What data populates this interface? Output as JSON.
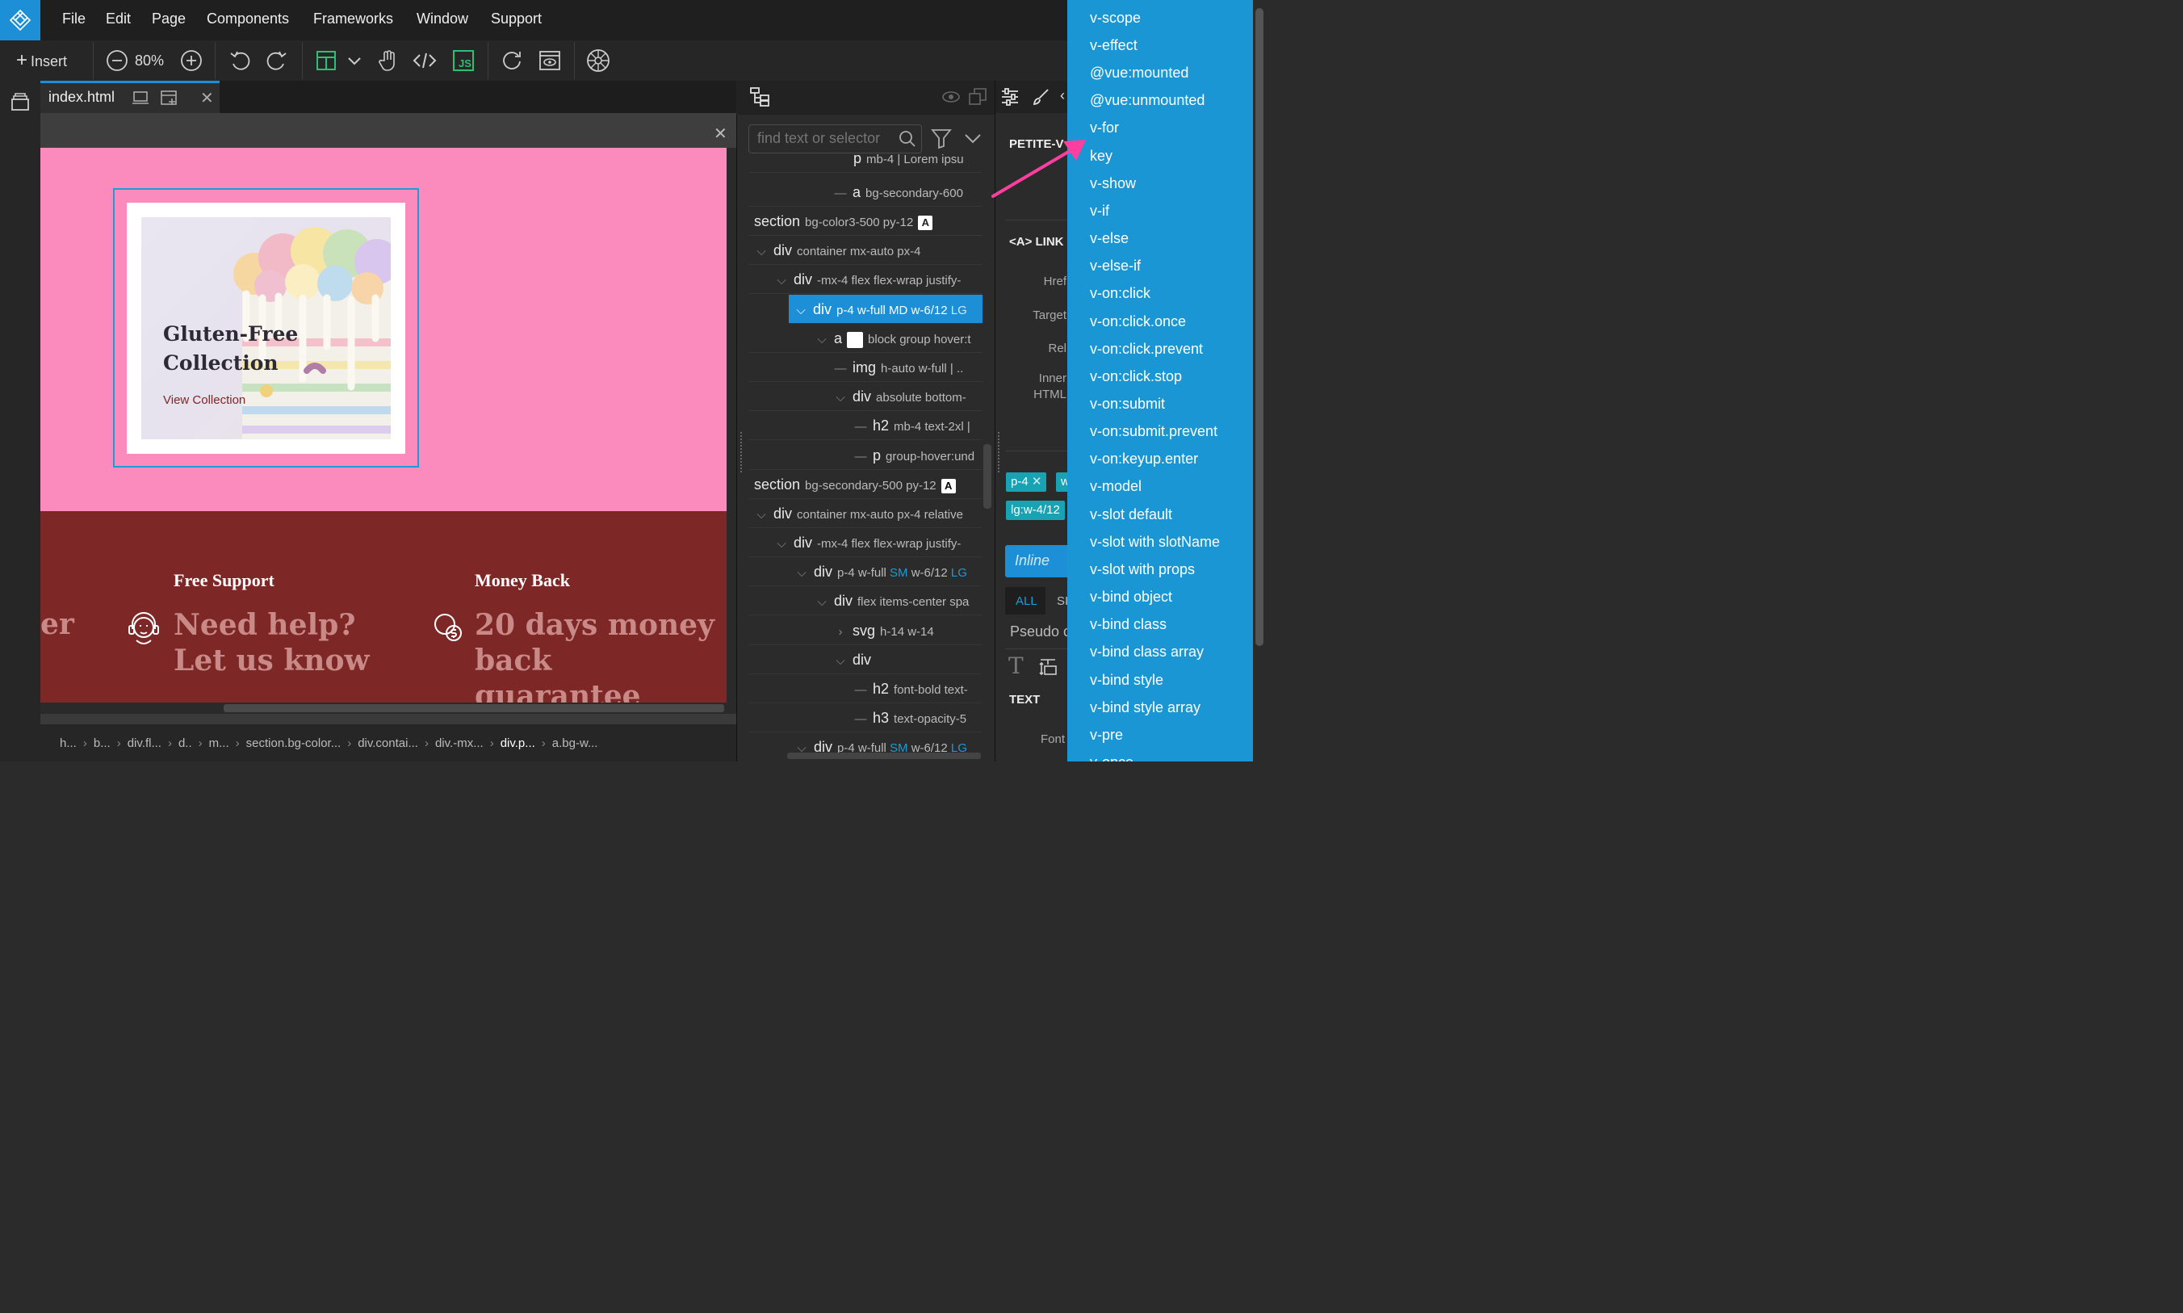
{
  "menubar": {
    "items": [
      "File",
      "Edit",
      "Page",
      "Components",
      "Frameworks",
      "Window",
      "Support"
    ]
  },
  "toolbar": {
    "insert_label": "Insert",
    "zoom": "80%"
  },
  "tab": {
    "filename": "index.html"
  },
  "page": {
    "card_title": "Gluten-Free Collection",
    "card_link": "View Collection",
    "feature_partial": "er",
    "feature1_title": "Free Support",
    "feature1_text": "Need help? Let us know",
    "feature2_title": "Money Back",
    "feature2_text": "20 days money back guarantee"
  },
  "breadcrumbs": [
    "h...",
    "b...",
    "div.fl...",
    "d..",
    "m...",
    "section.bg-color...",
    "div.contai...",
    "div.-mx...",
    "div.p...",
    "a.bg-w..."
  ],
  "tree": {
    "search_placeholder": "find text or selector",
    "rows": [
      {
        "tag": "p",
        "cls": "mb-4 | Lorem ipsu"
      },
      {
        "tag": "a",
        "cls": "bg-secondary-600"
      },
      {
        "tag": "section",
        "cls": "bg-color3-500 py-12",
        "badge": "A"
      },
      {
        "tag": "div",
        "cls": "container mx-auto px-4"
      },
      {
        "tag": "div",
        "cls": "-mx-4 flex flex-wrap justify-"
      },
      {
        "tag": "div",
        "cls": "p-4 w-full",
        "bp1": "MD",
        "cls2": "w-6/12",
        "bp2": "LG"
      },
      {
        "tag": "a",
        "cls": "block group hover:t"
      },
      {
        "tag": "img",
        "cls": "h-auto w-full | .."
      },
      {
        "tag": "div",
        "cls": "absolute bottom-"
      },
      {
        "tag": "h2",
        "cls": "mb-4 text-2xl |"
      },
      {
        "tag": "p",
        "cls": "group-hover:und"
      },
      {
        "tag": "section",
        "cls": "bg-secondary-500 py-12",
        "badge": "A"
      },
      {
        "tag": "div",
        "cls": "container mx-auto px-4 relative"
      },
      {
        "tag": "div",
        "cls": "-mx-4 flex flex-wrap justify-"
      },
      {
        "tag": "div",
        "cls": "p-4 w-full",
        "bp1": "SM",
        "cls2": "w-6/12",
        "bp2": "LG"
      },
      {
        "tag": "div",
        "cls": "flex items-center spa"
      },
      {
        "tag": "svg",
        "cls": "h-14 w-14"
      },
      {
        "tag": "div",
        "cls": ""
      },
      {
        "tag": "h2",
        "cls": "font-bold text-"
      },
      {
        "tag": "h3",
        "cls": "text-opacity-5"
      },
      {
        "tag": "div",
        "cls": "p-4 w-full",
        "bp1": "SM",
        "cls2": "w-6/12",
        "bp2": "LG"
      }
    ]
  },
  "props": {
    "section_title": "PETITE-V",
    "element_title": "<A> LINK",
    "href_label": "Href",
    "target_label": "Target",
    "rel_label": "Rel",
    "inner_html_label_1": "Inner",
    "inner_html_label_2": "HTML",
    "chip1": "p-4",
    "chip2": "w",
    "chip3": "lg:w-4/12",
    "inline_label": "Inline",
    "tab_all": "ALL",
    "tab_s": "SI",
    "pseudo_label": "Pseudo c",
    "text_heading": "TEXT",
    "font_label": "Font"
  },
  "dropdown": {
    "items": [
      "v-scope",
      "v-effect",
      "@vue:mounted",
      "@vue:unmounted",
      "v-for",
      "key",
      "v-show",
      "v-if",
      "v-else",
      "v-else-if",
      "v-on:click",
      "v-on:click.once",
      "v-on:click.prevent",
      "v-on:click.stop",
      "v-on:submit",
      "v-on:submit.prevent",
      "v-on:keyup.enter",
      "v-model",
      "v-slot default",
      "v-slot with slotName",
      "v-slot with props",
      "v-bind object",
      "v-bind class",
      "v-bind class array",
      "v-bind style",
      "v-bind style array",
      "v-pre",
      "v-once"
    ]
  },
  "colors": {
    "accent": "#1d8fd6",
    "canvas_pink": "#fc8bbd",
    "footer_maroon": "#7d2726",
    "annotation_arrow": "#ff3fa0"
  }
}
